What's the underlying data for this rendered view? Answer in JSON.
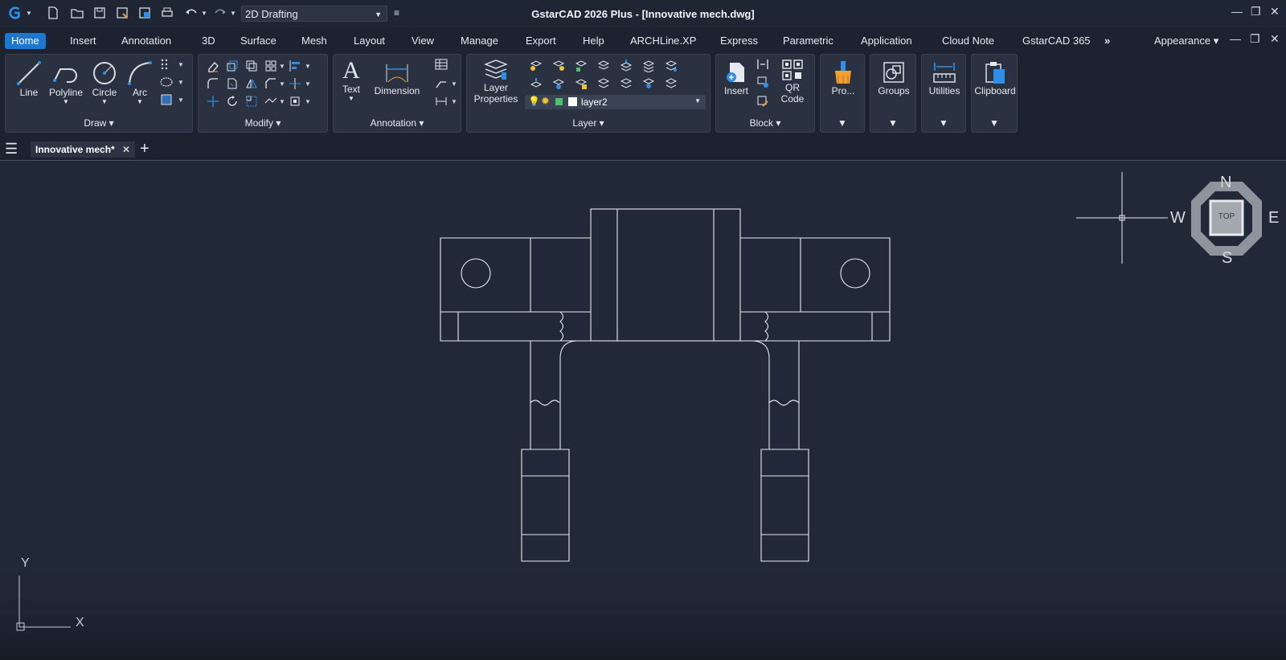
{
  "workspace": "2D Drafting",
  "app_title": "GstarCAD 2026 Plus - [Innovative mech.dwg]",
  "menu_tabs": [
    "Home",
    "Insert",
    "Annotation",
    "3D",
    "Surface",
    "Mesh",
    "Layout",
    "View",
    "Manage",
    "Export",
    "Help",
    "ARCHLine.XP",
    "Express",
    "Parametric",
    "Application",
    "Cloud Note",
    "GstarCAD 365"
  ],
  "overflow": "»",
  "appearance": "Appearance ▾",
  "draw": {
    "title": "Draw ▾",
    "line": "Line",
    "polyline": "Polyline",
    "circle": "Circle",
    "arc": "Arc"
  },
  "modify": {
    "title": "Modify ▾"
  },
  "annotation": {
    "title": "Annotation ▾",
    "text": "Text",
    "dimension": "Dimension"
  },
  "layer": {
    "title": "Layer ▾",
    "properties_line1": "Layer",
    "properties_line2": "Properties",
    "current": "layer2"
  },
  "block": {
    "title": "Block ▾",
    "insert": "Insert",
    "qr_line1": "QR",
    "qr_line2": "Code"
  },
  "pro": {
    "label": "Pro..."
  },
  "groups": {
    "label": "Groups"
  },
  "utilities": {
    "label": "Utilities"
  },
  "clipboard": {
    "label": "Clipboard"
  },
  "doc_tab": "Innovative mech*",
  "viewcube": {
    "n": "N",
    "s": "S",
    "e": "E",
    "w": "W",
    "face": "TOP"
  },
  "ucs": {
    "y": "Y",
    "x": "X"
  },
  "colors": {
    "accent": "#1b78d0",
    "canvas": "#212838",
    "ribbon": "#2a3242"
  }
}
